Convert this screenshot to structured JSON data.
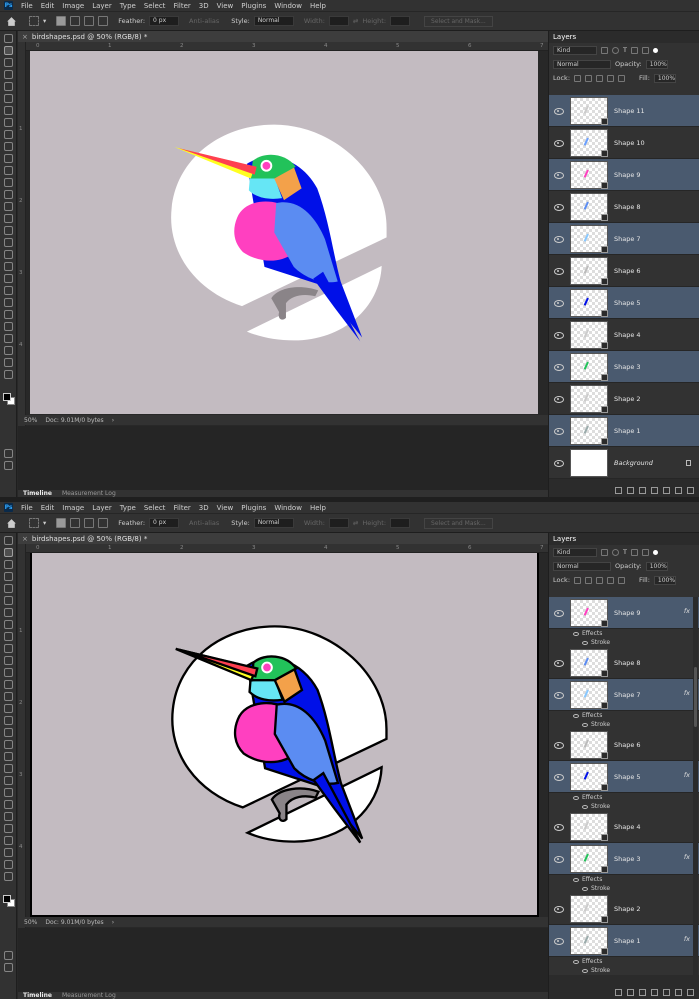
{
  "menu": [
    "File",
    "Edit",
    "Image",
    "Layer",
    "Type",
    "Select",
    "Filter",
    "3D",
    "View",
    "Plugins",
    "Window",
    "Help"
  ],
  "options": {
    "feather_label": "Feather:",
    "feather_value": "0 px",
    "antialias": "Anti-alias",
    "style_label": "Style:",
    "style_value": "Normal",
    "width_label": "Width:",
    "height_label": "Height:",
    "select_mask": "Select and Mask..."
  },
  "document": {
    "title": "birdshapes.psd @ 50% (RGB/8) *",
    "zoom": "50%",
    "doc_info": "Doc: 9.01M/0 bytes"
  },
  "rulers": {
    "h": [
      "0",
      "1",
      "2",
      "3",
      "4",
      "5",
      "6",
      "7"
    ],
    "v": [
      "1",
      "2",
      "3",
      "4"
    ]
  },
  "bottom_tabs": {
    "timeline": "Timeline",
    "measurement": "Measurement Log"
  },
  "layers_panel": {
    "tab": "Layers",
    "kind": "Kind",
    "blend": "Normal",
    "opacity_label": "Opacity:",
    "opacity": "100%",
    "lock_label": "Lock:",
    "fill_label": "Fill:",
    "fill": "100%"
  },
  "screen1_layers": [
    {
      "name": "Shape 11",
      "selected": true
    },
    {
      "name": "Shape 10",
      "selected": false
    },
    {
      "name": "Shape 9",
      "selected": true
    },
    {
      "name": "Shape 8",
      "selected": false
    },
    {
      "name": "Shape 7",
      "selected": true
    },
    {
      "name": "Shape 6",
      "selected": false
    },
    {
      "name": "Shape 5",
      "selected": true
    },
    {
      "name": "Shape 4",
      "selected": false
    },
    {
      "name": "Shape 3",
      "selected": true
    },
    {
      "name": "Shape 2",
      "selected": false
    },
    {
      "name": "Shape 1",
      "selected": true
    },
    {
      "name": "Background",
      "selected": false
    }
  ],
  "screen2_layers": [
    {
      "name": "Shape 9",
      "selected": true,
      "fx": true
    },
    {
      "name": "Shape 8",
      "selected": false,
      "fx": false
    },
    {
      "name": "Shape 7",
      "selected": true,
      "fx": true
    },
    {
      "name": "Shape 6",
      "selected": false,
      "fx": false
    },
    {
      "name": "Shape 5",
      "selected": true,
      "fx": true
    },
    {
      "name": "Shape 4",
      "selected": false,
      "fx": false
    },
    {
      "name": "Shape 3",
      "selected": true,
      "fx": true
    },
    {
      "name": "Shape 2",
      "selected": false,
      "fx": false
    },
    {
      "name": "Shape 1",
      "selected": true,
      "fx": true
    }
  ],
  "effects_label": "Effects",
  "stroke_label": "Stroke",
  "fx_label": "fx",
  "colors": {
    "canvas_bg": "#c3bbc1",
    "selected_layer": "#4a5a6f",
    "bird_blue": "#0010e8",
    "bird_pink": "#ff40c0",
    "beak_yellow": "#ffff20"
  }
}
